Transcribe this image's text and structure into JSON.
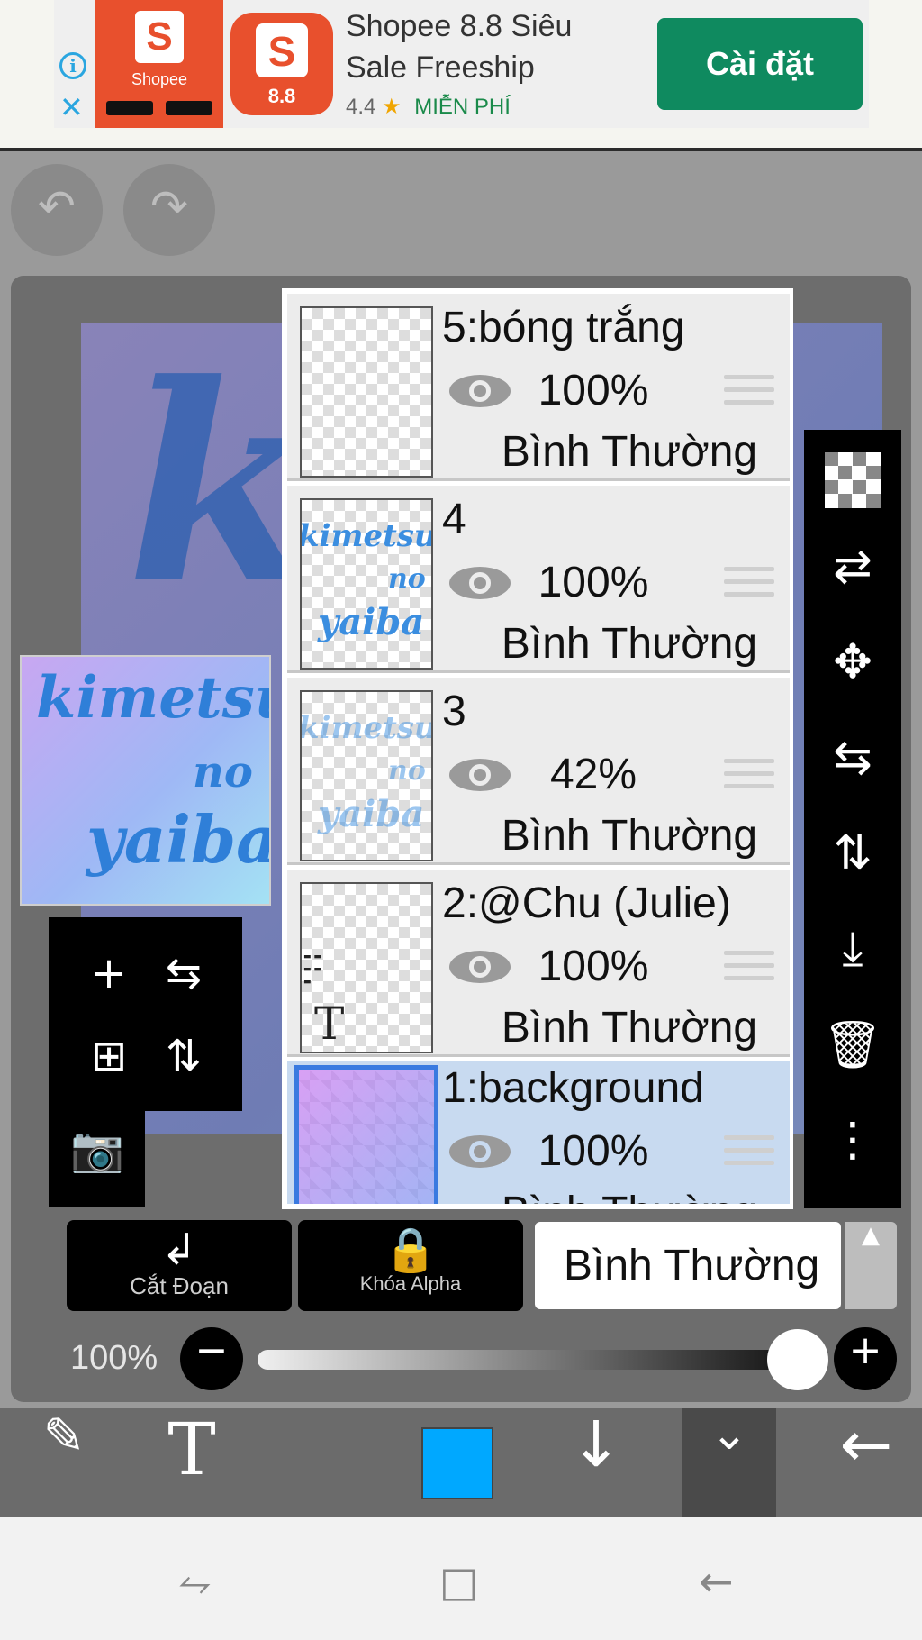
{
  "ad": {
    "logo_text": "Shopee",
    "logo_badge": "8.8",
    "title": "Shopee 8.8 Siêu Sale Freeship",
    "rating": "4.4",
    "price": "MIỄN PHÍ",
    "install_label": "Cài đặt",
    "info_icon": "info-icon",
    "close_icon": "close-icon"
  },
  "canvas": {
    "thumb_text": [
      "kimetsu",
      "no",
      "yaiba"
    ]
  },
  "layers": [
    {
      "name": "5:bóng trắng",
      "opacity": "100%",
      "blend": "Bình Thường",
      "selected": false
    },
    {
      "name": "4",
      "opacity": "100%",
      "blend": "Bình Thường",
      "selected": false
    },
    {
      "name": "3",
      "opacity": "42%",
      "blend": "Bình Thường",
      "selected": false
    },
    {
      "name": "2:@Chu (Julie)",
      "opacity": "100%",
      "blend": "Bình Thường",
      "selected": false
    },
    {
      "name": "1:background",
      "opacity": "100%",
      "blend": "Bình Thường",
      "selected": true
    }
  ],
  "layer_controls": {
    "clipping_label": "Cắt Đoạn",
    "alpha_lock_label": "Khóa Alpha",
    "blend_mode": "Bình Thường"
  },
  "opacity": {
    "label": "100%",
    "value": 1.0
  },
  "toolbar": {
    "brush_color": "#00a8ff"
  },
  "colors": {
    "ad_install_bg": "#0f8a5f",
    "shopee_orange": "#e8502d",
    "selected_layer_bg": "#c8daf0"
  }
}
